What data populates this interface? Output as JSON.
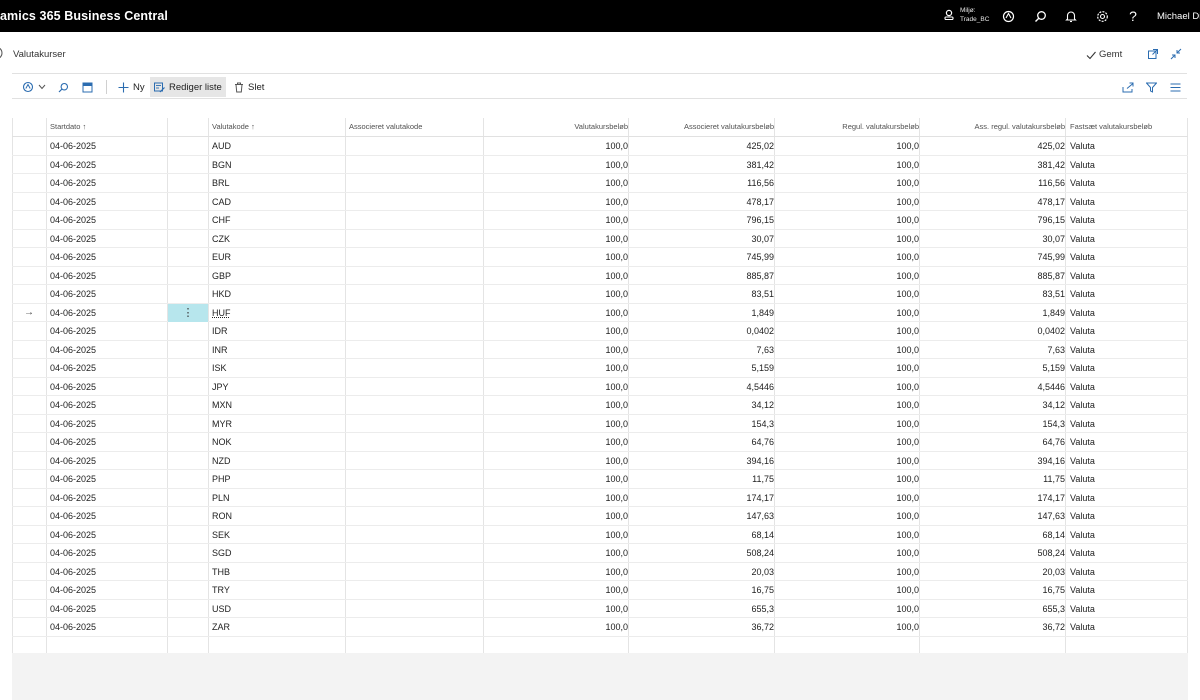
{
  "app": {
    "title": "amics 365 Business Central",
    "environment_label": "Miljø:",
    "environment_name": "Trade_BC",
    "user": "Michael Die"
  },
  "page": {
    "title": "Valutakurser",
    "saved_label": "Gemt"
  },
  "actions": {
    "new": "Ny",
    "edit_list": "Rediger liste",
    "delete": "Slet"
  },
  "columns": {
    "start_date": "Startdato",
    "currency_code": "Valutakode",
    "assoc_currency_code": "Associeret valutakode",
    "exchange_rate_amount": "Valutakursbeløb",
    "assoc_exchange_rate_amount": "Associeret valutakursbeløb",
    "adj_exchange_rate_amount": "Regul. valutakursbeløb",
    "assoc_adj_exchange_rate_amount": "Ass. regul. valutakursbeløb",
    "fix_exchange_rate_amount": "Fastsæt valutakursbeløb"
  },
  "rows": [
    {
      "date": "04-06-2025",
      "code": "AUD",
      "amount": "100,0",
      "assoc": "425,02",
      "adj": "100,0",
      "assoc_adj": "425,02",
      "fix": "Valuta"
    },
    {
      "date": "04-06-2025",
      "code": "BGN",
      "amount": "100,0",
      "assoc": "381,42",
      "adj": "100,0",
      "assoc_adj": "381,42",
      "fix": "Valuta"
    },
    {
      "date": "04-06-2025",
      "code": "BRL",
      "amount": "100,0",
      "assoc": "116,56",
      "adj": "100,0",
      "assoc_adj": "116,56",
      "fix": "Valuta"
    },
    {
      "date": "04-06-2025",
      "code": "CAD",
      "amount": "100,0",
      "assoc": "478,17",
      "adj": "100,0",
      "assoc_adj": "478,17",
      "fix": "Valuta"
    },
    {
      "date": "04-06-2025",
      "code": "CHF",
      "amount": "100,0",
      "assoc": "796,15",
      "adj": "100,0",
      "assoc_adj": "796,15",
      "fix": "Valuta"
    },
    {
      "date": "04-06-2025",
      "code": "CZK",
      "amount": "100,0",
      "assoc": "30,07",
      "adj": "100,0",
      "assoc_adj": "30,07",
      "fix": "Valuta"
    },
    {
      "date": "04-06-2025",
      "code": "EUR",
      "amount": "100,0",
      "assoc": "745,99",
      "adj": "100,0",
      "assoc_adj": "745,99",
      "fix": "Valuta"
    },
    {
      "date": "04-06-2025",
      "code": "GBP",
      "amount": "100,0",
      "assoc": "885,87",
      "adj": "100,0",
      "assoc_adj": "885,87",
      "fix": "Valuta"
    },
    {
      "date": "04-06-2025",
      "code": "HKD",
      "amount": "100,0",
      "assoc": "83,51",
      "adj": "100,0",
      "assoc_adj": "83,51",
      "fix": "Valuta"
    },
    {
      "date": "04-06-2025",
      "code": "HUF",
      "amount": "100,0",
      "assoc": "1,849",
      "adj": "100,0",
      "assoc_adj": "1,849",
      "fix": "Valuta"
    },
    {
      "date": "04-06-2025",
      "code": "IDR",
      "amount": "100,0",
      "assoc": "0,0402",
      "adj": "100,0",
      "assoc_adj": "0,0402",
      "fix": "Valuta"
    },
    {
      "date": "04-06-2025",
      "code": "INR",
      "amount": "100,0",
      "assoc": "7,63",
      "adj": "100,0",
      "assoc_adj": "7,63",
      "fix": "Valuta"
    },
    {
      "date": "04-06-2025",
      "code": "ISK",
      "amount": "100,0",
      "assoc": "5,159",
      "adj": "100,0",
      "assoc_adj": "5,159",
      "fix": "Valuta"
    },
    {
      "date": "04-06-2025",
      "code": "JPY",
      "amount": "100,0",
      "assoc": "4,5446",
      "adj": "100,0",
      "assoc_adj": "4,5446",
      "fix": "Valuta"
    },
    {
      "date": "04-06-2025",
      "code": "MXN",
      "amount": "100,0",
      "assoc": "34,12",
      "adj": "100,0",
      "assoc_adj": "34,12",
      "fix": "Valuta"
    },
    {
      "date": "04-06-2025",
      "code": "MYR",
      "amount": "100,0",
      "assoc": "154,3",
      "adj": "100,0",
      "assoc_adj": "154,3",
      "fix": "Valuta"
    },
    {
      "date": "04-06-2025",
      "code": "NOK",
      "amount": "100,0",
      "assoc": "64,76",
      "adj": "100,0",
      "assoc_adj": "64,76",
      "fix": "Valuta"
    },
    {
      "date": "04-06-2025",
      "code": "NZD",
      "amount": "100,0",
      "assoc": "394,16",
      "adj": "100,0",
      "assoc_adj": "394,16",
      "fix": "Valuta"
    },
    {
      "date": "04-06-2025",
      "code": "PHP",
      "amount": "100,0",
      "assoc": "11,75",
      "adj": "100,0",
      "assoc_adj": "11,75",
      "fix": "Valuta"
    },
    {
      "date": "04-06-2025",
      "code": "PLN",
      "amount": "100,0",
      "assoc": "174,17",
      "adj": "100,0",
      "assoc_adj": "174,17",
      "fix": "Valuta"
    },
    {
      "date": "04-06-2025",
      "code": "RON",
      "amount": "100,0",
      "assoc": "147,63",
      "adj": "100,0",
      "assoc_adj": "147,63",
      "fix": "Valuta"
    },
    {
      "date": "04-06-2025",
      "code": "SEK",
      "amount": "100,0",
      "assoc": "68,14",
      "adj": "100,0",
      "assoc_adj": "68,14",
      "fix": "Valuta"
    },
    {
      "date": "04-06-2025",
      "code": "SGD",
      "amount": "100,0",
      "assoc": "508,24",
      "adj": "100,0",
      "assoc_adj": "508,24",
      "fix": "Valuta"
    },
    {
      "date": "04-06-2025",
      "code": "THB",
      "amount": "100,0",
      "assoc": "20,03",
      "adj": "100,0",
      "assoc_adj": "20,03",
      "fix": "Valuta"
    },
    {
      "date": "04-06-2025",
      "code": "TRY",
      "amount": "100,0",
      "assoc": "16,75",
      "adj": "100,0",
      "assoc_adj": "16,75",
      "fix": "Valuta"
    },
    {
      "date": "04-06-2025",
      "code": "USD",
      "amount": "100,0",
      "assoc": "655,3",
      "adj": "100,0",
      "assoc_adj": "655,3",
      "fix": "Valuta"
    },
    {
      "date": "04-06-2025",
      "code": "ZAR",
      "amount": "100,0",
      "assoc": "36,72",
      "adj": "100,0",
      "assoc_adj": "36,72",
      "fix": "Valuta"
    }
  ],
  "selected_row_index": 9,
  "icons": {
    "environment": "environment-icon",
    "copilot": "copilot-icon",
    "search": "search-icon",
    "bell": "bell-icon",
    "settings": "gear-icon",
    "help": "help-icon"
  }
}
